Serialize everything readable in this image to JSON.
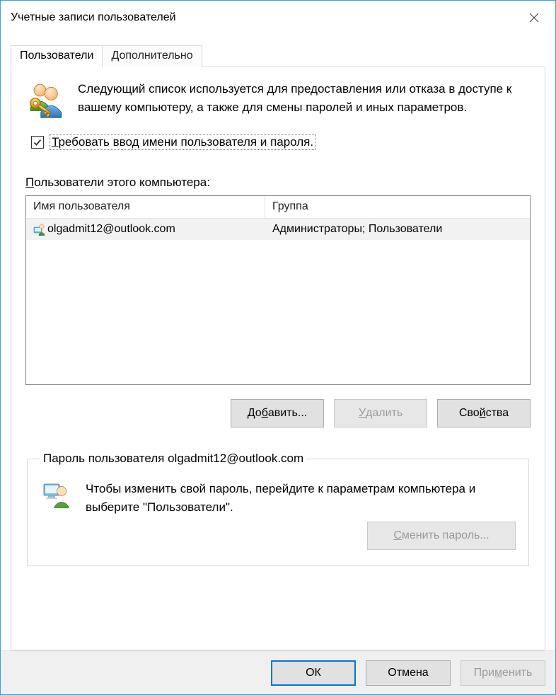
{
  "window": {
    "title": "Учетные записи пользователей"
  },
  "tabs": {
    "users": "Пользователи",
    "advanced": "Дополнительно"
  },
  "intro": "Следующий список используется для предоставления или отказа в доступе к вашему компьютеру, а также для смены паролей и иных параметров.",
  "require_credentials": {
    "checked": true,
    "label_pre_u": "Т",
    "label_rest": "ребовать ввод имени пользователя и пароля."
  },
  "user_list": {
    "label_pre_u": "П",
    "label_rest": "ользователи этого компьютера:",
    "columns": {
      "name": "Имя пользователя",
      "group": "Группа"
    },
    "rows": [
      {
        "name": "olgadmit12@outlook.com",
        "group": "Администраторы; Пользователи"
      }
    ]
  },
  "buttons": {
    "add_pre": "До",
    "add_u": "б",
    "add_post": "авить...",
    "remove_pre": "",
    "remove_u": "У",
    "remove_post": "далить",
    "props_pre": "Сво",
    "props_u": "й",
    "props_post": "ства"
  },
  "password_group": {
    "legend": "Пароль пользователя olgadmit12@outlook.com",
    "text": "Чтобы изменить свой пароль, перейдите к параметрам компьютера и выберите \"Пользователи\".",
    "change_pre": "",
    "change_u": "С",
    "change_post": "менить пароль..."
  },
  "footer": {
    "ok": "ОК",
    "cancel": "Отмена",
    "apply_pre": "При",
    "apply_u": "м",
    "apply_post": "енить"
  }
}
